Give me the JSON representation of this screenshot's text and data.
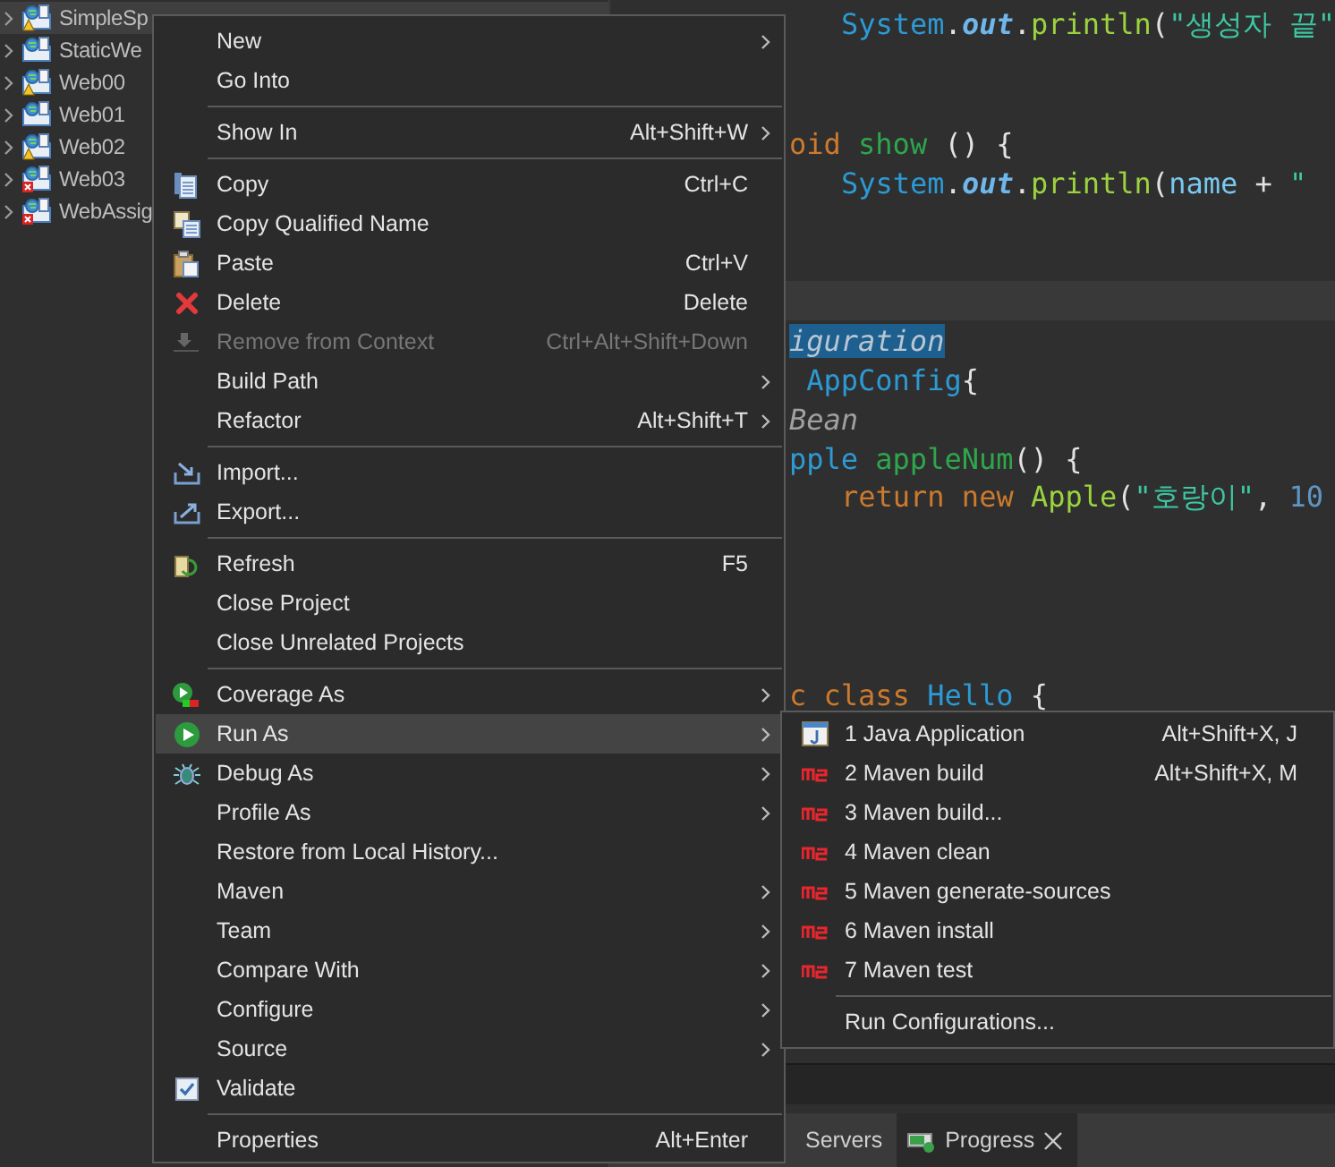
{
  "project_tree": {
    "items": [
      {
        "label": "SimpleSp",
        "selected": true,
        "warning": true,
        "error": false
      },
      {
        "label": "StaticWe",
        "selected": false,
        "warning": false,
        "error": false
      },
      {
        "label": "Web00",
        "selected": false,
        "warning": true,
        "error": false
      },
      {
        "label": "Web01",
        "selected": false,
        "warning": false,
        "error": false
      },
      {
        "label": "Web02",
        "selected": false,
        "warning": true,
        "error": false
      },
      {
        "label": "Web03",
        "selected": false,
        "warning": false,
        "error": true
      },
      {
        "label": "WebAssig",
        "selected": false,
        "warning": false,
        "error": true
      }
    ]
  },
  "editor": {
    "lines": [
      {
        "kind": "code",
        "indented": true,
        "tokens": [
          {
            "text": "System",
            "kind": "type"
          },
          {
            "text": ".",
            "kind": "plain"
          },
          {
            "text": "out",
            "kind": "field"
          },
          {
            "text": ".",
            "kind": "plain"
          },
          {
            "text": "println",
            "kind": "method"
          },
          {
            "text": "(",
            "kind": "plain"
          },
          {
            "text": "\"생성자 끝\"",
            "kind": "string"
          }
        ]
      },
      {
        "kind": "blank"
      },
      {
        "kind": "blank"
      },
      {
        "kind": "code",
        "indented": false,
        "tokens": [
          {
            "text": "oid",
            "kind": "keyword"
          },
          {
            "text": " show",
            "kind": "name"
          },
          {
            "text": " () {",
            "kind": "plain"
          }
        ]
      },
      {
        "kind": "code",
        "indented": true,
        "tokens": [
          {
            "text": "System",
            "kind": "type"
          },
          {
            "text": ".",
            "kind": "plain"
          },
          {
            "text": "out",
            "kind": "field"
          },
          {
            "text": ".",
            "kind": "plain"
          },
          {
            "text": "println",
            "kind": "method"
          },
          {
            "text": "(",
            "kind": "plain"
          },
          {
            "text": "name",
            "kind": "variable"
          },
          {
            "text": " + ",
            "kind": "plain"
          },
          {
            "text": "\"",
            "kind": "string"
          }
        ]
      },
      {
        "kind": "blank"
      },
      {
        "kind": "blank"
      },
      {
        "kind": "current"
      },
      {
        "kind": "code",
        "indented": false,
        "tokens": [
          {
            "text": "iguration",
            "kind": "selection"
          }
        ]
      },
      {
        "kind": "code",
        "indented": false,
        "tokens": [
          {
            "text": " AppConfig",
            "kind": "type"
          },
          {
            "text": "{",
            "kind": "plain"
          }
        ]
      },
      {
        "kind": "code",
        "indented": false,
        "tokens": [
          {
            "text": "Bean",
            "kind": "annotation"
          }
        ]
      },
      {
        "kind": "code",
        "indented": false,
        "tokens": [
          {
            "text": "pple",
            "kind": "type"
          },
          {
            "text": " appleNum",
            "kind": "name"
          },
          {
            "text": "() {",
            "kind": "plain"
          }
        ]
      },
      {
        "kind": "code",
        "indented": true,
        "tokens": [
          {
            "text": "return new",
            "kind": "keyword"
          },
          {
            "text": " Apple",
            "kind": "method"
          },
          {
            "text": "(",
            "kind": "plain"
          },
          {
            "text": "\"호랑이\"",
            "kind": "string"
          },
          {
            "text": ", ",
            "kind": "plain"
          },
          {
            "text": "10",
            "kind": "number"
          }
        ]
      },
      {
        "kind": "blank"
      },
      {
        "kind": "blank"
      },
      {
        "kind": "blank"
      },
      {
        "kind": "blank"
      },
      {
        "kind": "code",
        "indented": false,
        "tokens": [
          {
            "text": "c class",
            "kind": "keyword"
          },
          {
            "text": " Hello",
            "kind": "type"
          },
          {
            "text": " {",
            "kind": "plain"
          }
        ]
      }
    ]
  },
  "bottom_tabs": [
    {
      "label": "Servers",
      "selected": false,
      "closable": false
    },
    {
      "label": "Progress",
      "selected": true,
      "closable": true
    }
  ],
  "context_menu": {
    "items": [
      {
        "kind": "item",
        "label": "New",
        "submenu": true,
        "disabled": false,
        "selected": false
      },
      {
        "kind": "item",
        "label": "Go Into",
        "submenu": false,
        "disabled": false,
        "selected": false
      },
      {
        "kind": "separator"
      },
      {
        "kind": "item",
        "label": "Show In",
        "shortcut": "Alt+Shift+W",
        "submenu": true,
        "disabled": false,
        "selected": false
      },
      {
        "kind": "separator"
      },
      {
        "kind": "item",
        "label": "Copy",
        "shortcut": "Ctrl+C",
        "submenu": false,
        "disabled": false,
        "selected": false
      },
      {
        "kind": "item",
        "label": "Copy Qualified Name",
        "submenu": false,
        "disabled": false,
        "selected": false
      },
      {
        "kind": "item",
        "label": "Paste",
        "shortcut": "Ctrl+V",
        "submenu": false,
        "disabled": false,
        "selected": false
      },
      {
        "kind": "item",
        "label": "Delete",
        "shortcut": "Delete",
        "submenu": false,
        "disabled": false,
        "selected": false
      },
      {
        "kind": "item",
        "label": "Remove from Context",
        "shortcut": "Ctrl+Alt+Shift+Down",
        "submenu": false,
        "disabled": true,
        "selected": false
      },
      {
        "kind": "item",
        "label": "Build Path",
        "submenu": true,
        "disabled": false,
        "selected": false
      },
      {
        "kind": "item",
        "label": "Refactor",
        "shortcut": "Alt+Shift+T",
        "submenu": true,
        "disabled": false,
        "selected": false
      },
      {
        "kind": "separator"
      },
      {
        "kind": "item",
        "label": "Import...",
        "submenu": false,
        "disabled": false,
        "selected": false
      },
      {
        "kind": "item",
        "label": "Export...",
        "submenu": false,
        "disabled": false,
        "selected": false
      },
      {
        "kind": "separator"
      },
      {
        "kind": "item",
        "label": "Refresh",
        "shortcut": "F5",
        "submenu": false,
        "disabled": false,
        "selected": false
      },
      {
        "kind": "item",
        "label": "Close Project",
        "submenu": false,
        "disabled": false,
        "selected": false
      },
      {
        "kind": "item",
        "label": "Close Unrelated Projects",
        "submenu": false,
        "disabled": false,
        "selected": false
      },
      {
        "kind": "separator"
      },
      {
        "kind": "item",
        "label": "Coverage As",
        "submenu": true,
        "disabled": false,
        "selected": false
      },
      {
        "kind": "item",
        "label": "Run As",
        "submenu": true,
        "disabled": false,
        "selected": true
      },
      {
        "kind": "item",
        "label": "Debug As",
        "submenu": true,
        "disabled": false,
        "selected": false
      },
      {
        "kind": "item",
        "label": "Profile As",
        "submenu": true,
        "disabled": false,
        "selected": false
      },
      {
        "kind": "item",
        "label": "Restore from Local History...",
        "submenu": false,
        "disabled": false,
        "selected": false
      },
      {
        "kind": "item",
        "label": "Maven",
        "submenu": true,
        "disabled": false,
        "selected": false
      },
      {
        "kind": "item",
        "label": "Team",
        "submenu": true,
        "disabled": false,
        "selected": false
      },
      {
        "kind": "item",
        "label": "Compare With",
        "submenu": true,
        "disabled": false,
        "selected": false
      },
      {
        "kind": "item",
        "label": "Configure",
        "submenu": true,
        "disabled": false,
        "selected": false
      },
      {
        "kind": "item",
        "label": "Source",
        "submenu": true,
        "disabled": false,
        "selected": false
      },
      {
        "kind": "item",
        "label": "Validate",
        "submenu": false,
        "disabled": false,
        "selected": false
      },
      {
        "kind": "separator"
      },
      {
        "kind": "item",
        "label": "Properties",
        "shortcut": "Alt+Enter",
        "submenu": false,
        "disabled": false,
        "selected": false
      }
    ]
  },
  "run_as_submenu": {
    "items": [
      {
        "kind": "item",
        "label": "1 Java Application",
        "shortcut": "Alt+Shift+X, J"
      },
      {
        "kind": "item",
        "label": "2 Maven build",
        "shortcut": "Alt+Shift+X, M"
      },
      {
        "kind": "item",
        "label": "3 Maven build..."
      },
      {
        "kind": "item",
        "label": "4 Maven clean"
      },
      {
        "kind": "item",
        "label": "5 Maven generate-sources"
      },
      {
        "kind": "item",
        "label": "6 Maven install"
      },
      {
        "kind": "item",
        "label": "7 Maven test"
      },
      {
        "kind": "separator"
      },
      {
        "kind": "item",
        "label": "Run Configurations..."
      }
    ]
  }
}
